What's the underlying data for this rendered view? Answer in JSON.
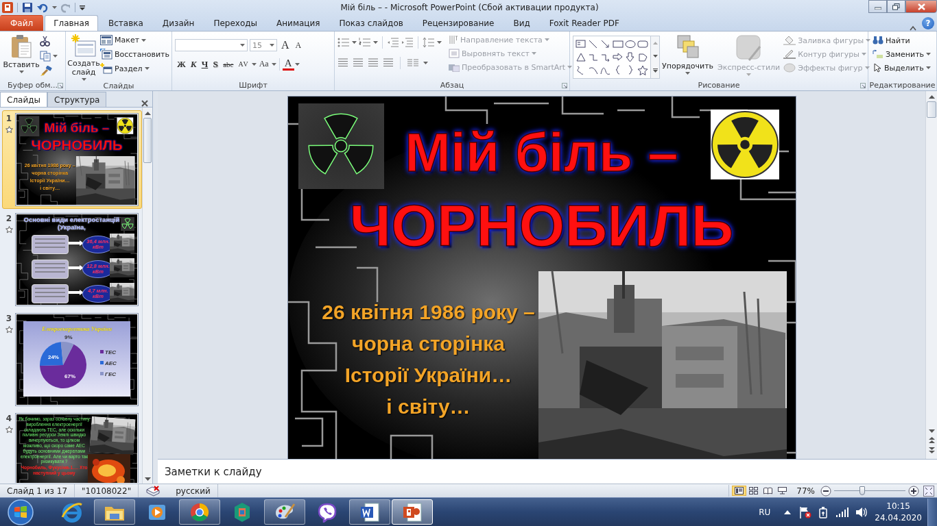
{
  "window": {
    "title": "Мій біль – - Microsoft PowerPoint (Сбой активации продукта)"
  },
  "ribbon_tabs": [
    {
      "label": "Файл",
      "kind": "file",
      "selected": false
    },
    {
      "label": "Главная",
      "kind": "tab",
      "selected": true
    },
    {
      "label": "Вставка",
      "kind": "tab",
      "selected": false
    },
    {
      "label": "Дизайн",
      "kind": "tab",
      "selected": false
    },
    {
      "label": "Переходы",
      "kind": "tab",
      "selected": false
    },
    {
      "label": "Анимация",
      "kind": "tab",
      "selected": false
    },
    {
      "label": "Показ слайдов",
      "kind": "tab",
      "selected": false
    },
    {
      "label": "Рецензирование",
      "kind": "tab",
      "selected": false
    },
    {
      "label": "Вид",
      "kind": "tab",
      "selected": false
    },
    {
      "label": "Foxit Reader PDF",
      "kind": "tab",
      "selected": false
    }
  ],
  "help": "?",
  "ribbon_groups": [
    {
      "label": "Буфер обм...",
      "buttons": [
        {
          "label": "Вставить",
          "disabled": false
        }
      ]
    },
    {
      "label": "Слайды",
      "buttons": [
        {
          "label": "Создать слайд",
          "disabled": false
        },
        {
          "label": "Макет",
          "disabled": false
        },
        {
          "label": "Восстановить",
          "disabled": false
        },
        {
          "label": "Раздел",
          "disabled": false
        }
      ]
    },
    {
      "label": "Шрифт",
      "font_size": "15",
      "buttons": [
        {
          "label": "A",
          "kind": "grow"
        },
        {
          "label": "A",
          "kind": "shrink"
        },
        {
          "label": "Ж",
          "kind": "bold"
        },
        {
          "label": "К",
          "kind": "italic"
        },
        {
          "label": "Ч",
          "kind": "underline"
        },
        {
          "label": "S",
          "kind": "shadow"
        },
        {
          "label": "abc",
          "kind": "strike"
        },
        {
          "label": "AV",
          "kind": "spacing"
        },
        {
          "label": "Aa",
          "kind": "case"
        },
        {
          "label": "A",
          "kind": "color"
        }
      ]
    },
    {
      "label": "Абзац",
      "buttons": [
        {
          "label": "Направление текста",
          "disabled": true
        },
        {
          "label": "Выровнять текст",
          "disabled": true
        },
        {
          "label": "Преобразовать в SmartArt",
          "disabled": true
        }
      ]
    },
    {
      "label": "Рисование",
      "buttons": [
        {
          "label": "Упорядочить",
          "disabled": false
        },
        {
          "label": "Экспресс-стили",
          "disabled": true
        },
        {
          "label": "Заливка фигуры",
          "disabled": true
        },
        {
          "label": "Контур фигуры",
          "disabled": true
        },
        {
          "label": "Эффекты фигур",
          "disabled": true
        }
      ]
    },
    {
      "label": "Редактирование",
      "buttons": [
        {
          "label": "Найти",
          "disabled": false
        },
        {
          "label": "Заменить",
          "disabled": false
        },
        {
          "label": "Выделить",
          "disabled": false
        }
      ]
    }
  ],
  "pane_tabs": [
    {
      "label": "Слайды",
      "selected": true
    },
    {
      "label": "Структура",
      "selected": false
    }
  ],
  "thumbnails": [
    {
      "number": "1",
      "kind": "title",
      "selected": true,
      "title": [
        "Мій біль –",
        "ЧОРНОБИЛЬ"
      ],
      "subtitle": [
        "26 квітня 1986 року –",
        "чорна сторінка",
        "Історії України…",
        "і світу…"
      ]
    },
    {
      "number": "2",
      "kind": "stations",
      "selected": false,
      "title": "Основні види електростанцій (Україна,",
      "values": [
        "36,4 млн. кВт",
        "12,8 млн. кВт",
        "4,7 млн. кВт"
      ]
    },
    {
      "number": "3",
      "kind": "chart",
      "selected": false,
      "chart_data": {
        "type": "pie",
        "title": "Елекроенергетика України",
        "categories": [
          "ТЕС",
          "АЕС",
          "ГЕС"
        ],
        "values": [
          67,
          24,
          9
        ],
        "value_labels": [
          "67%",
          "24%",
          "9%"
        ],
        "legend": "right"
      }
    },
    {
      "number": "4",
      "kind": "text",
      "selected": false,
      "paragraphs": [
        "Як бачимо, зараз основну частину вироблення електроенергії складають ТЕС, але оскільки паливні ресурси Землі швидко вичерпуються, то цілком можливо, що скоро саме АЕС будуть основними джерелами електроенергії. Але чи варто так ризикувати ?",
        "Чорнобиль, Фукусіма-1…. Хто наступний у цьому"
      ]
    }
  ],
  "slide": {
    "title": [
      "Мій біль –",
      "ЧОРНОБИЛЬ"
    ],
    "subtitle": [
      "26 квітня 1986 року –",
      "чорна сторінка",
      "Історії України…",
      "і світу…"
    ]
  },
  "notes": {
    "placeholder": "Заметки к слайду"
  },
  "status_bar": {
    "slide": "Слайд 1 из 17",
    "theme": "\"10108022\"",
    "language": "русский",
    "zoom": "77%",
    "zoom_slider": {
      "level": 0.39
    }
  },
  "taskbar": {
    "apps": [
      {
        "kind": "ie",
        "running": false,
        "selected": false
      },
      {
        "kind": "folder",
        "running": true,
        "selected": false
      },
      {
        "kind": "media",
        "running": false,
        "selected": false
      },
      {
        "kind": "chrome",
        "running": true,
        "selected": false
      },
      {
        "kind": "store",
        "running": false,
        "selected": false
      },
      {
        "kind": "paint",
        "running": true,
        "selected": false
      },
      {
        "kind": "viber",
        "running": false,
        "selected": false
      },
      {
        "kind": "word",
        "running": true,
        "selected": false
      },
      {
        "kind": "powerpoint",
        "running": true,
        "selected": true
      }
    ],
    "language": "RU",
    "time": "10:15",
    "date": "24.04.2020"
  }
}
